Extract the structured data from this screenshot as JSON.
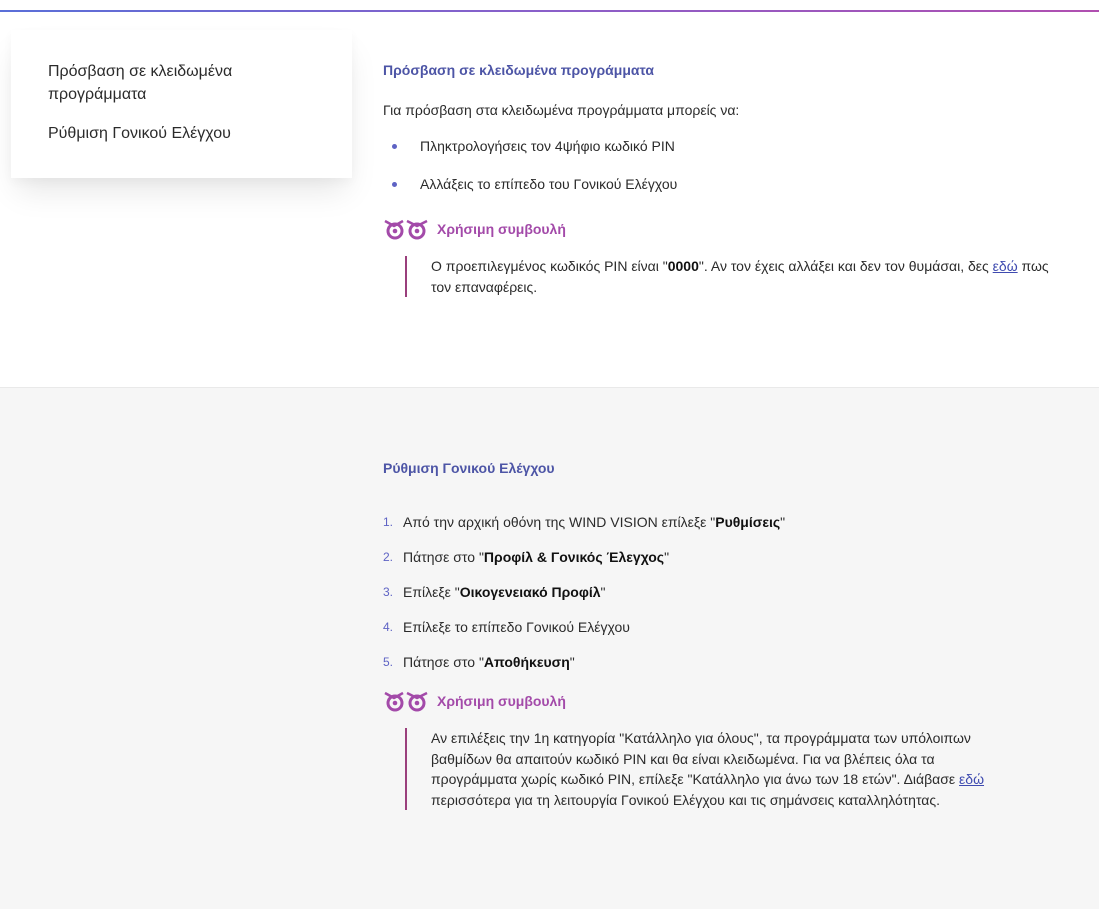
{
  "sidebar": {
    "items": [
      {
        "label": "Πρόσβαση σε κλειδωμένα προγράμματα"
      },
      {
        "label": "Ρύθμιση Γονικού Ελέγχου"
      }
    ]
  },
  "section1": {
    "title": "Πρόσβαση σε κλειδωμένα προγράμματα",
    "intro": "Για πρόσβαση στα κλειδωμένα προγράμματα μπορείς να:",
    "bullets": [
      "Πληκτρολογήσεις τον 4ψήφιο κωδικό PIN",
      "Αλλάξεις το επίπεδο του Γονικού Ελέγχου"
    ],
    "tip": {
      "title": "Χρήσιμη συμβουλή",
      "text_a": "Ο προεπιλεγμένος κωδικός PIN είναι \"",
      "pin": "0000",
      "text_b": "\". Αν τον έχεις αλλάξει και δεν τον θυμάσαι, δες ",
      "link": "εδώ",
      "text_c": " πως τον επαναφέρεις."
    }
  },
  "section2": {
    "title": "Ρύθμιση Γονικού Ελέγχου",
    "steps": [
      {
        "num": "1.",
        "pre": "Από την αρχική οθόνη της WIND VISION επίλεξε \"",
        "bold": "Ρυθμίσεις",
        "post": "\""
      },
      {
        "num": "2.",
        "pre": "Πάτησε στο \"",
        "bold": "Προφίλ & Γονικός Έλεγχος",
        "post": "\""
      },
      {
        "num": "3.",
        "pre": "Επίλεξε \"",
        "bold": "Οικογενειακό Προφίλ",
        "post": "\""
      },
      {
        "num": "4.",
        "pre": "Επίλεξε το επίπεδο Γονικού Ελέγχου",
        "bold": "",
        "post": ""
      },
      {
        "num": "5.",
        "pre": "Πάτησε στο \"",
        "bold": "Αποθήκευση",
        "post": "\""
      }
    ],
    "tip": {
      "title": "Χρήσιμη συμβουλή",
      "text_a": "Αν επιλέξεις την 1η κατηγορία \"Κατάλληλο για όλους\", τα προγράμματα των υπόλοιπων βαθμίδων θα απαιτούν κωδικό PIN και θα είναι κλειδωμένα. Για να βλέπεις όλα τα προγράμματα χωρίς κωδικό PIN, επίλεξε \"Κατάλληλο για άνω των 18 ετών\". Διάβασε ",
      "link": "εδώ",
      "text_b": " περισσότερα για τη λειτουργία Γονικού Ελέγχου και τις σημάνσεις καταλληλότητας."
    }
  },
  "icons": {
    "tip": "owl-eyes-icon"
  },
  "colors": {
    "heading": "#4d55a6",
    "tip_title": "#a34aa9",
    "tip_border": "#9a3f7c",
    "bullet": "#5e63c4",
    "section_bg": "#f6f6f6"
  }
}
